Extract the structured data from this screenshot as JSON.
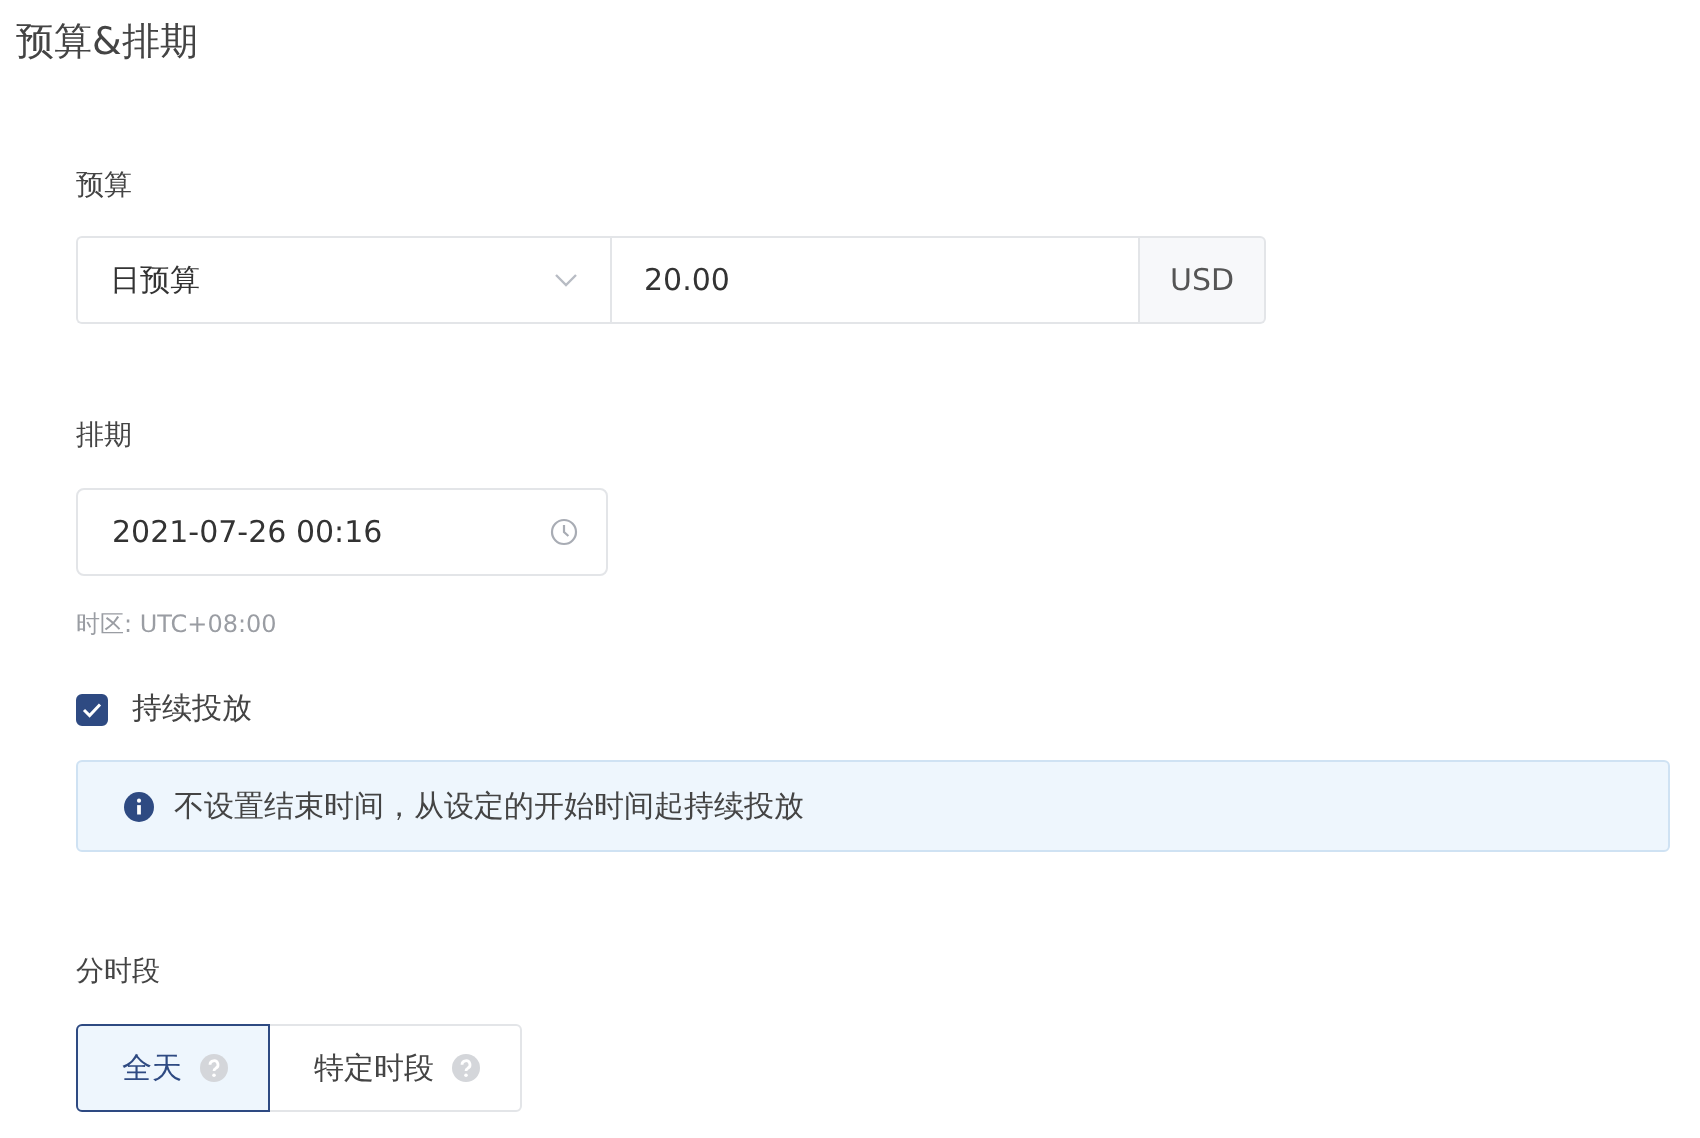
{
  "title": "预算&排期",
  "budget": {
    "label": "预算",
    "type_select": {
      "value": "日预算"
    },
    "amount": {
      "value": "20.00"
    },
    "currency": "USD"
  },
  "schedule": {
    "label": "排期",
    "start": {
      "value": "2021-07-26 00:16"
    },
    "timezone": "时区: UTC+08:00",
    "continuous": {
      "label": "持续投放",
      "checked": true
    },
    "info": "不设置结束时间，从设定的开始时间起持续投放"
  },
  "dayparting": {
    "label": "分时段",
    "options": [
      {
        "label": "全天",
        "selected": true
      },
      {
        "label": "特定时段",
        "selected": false
      }
    ]
  }
}
